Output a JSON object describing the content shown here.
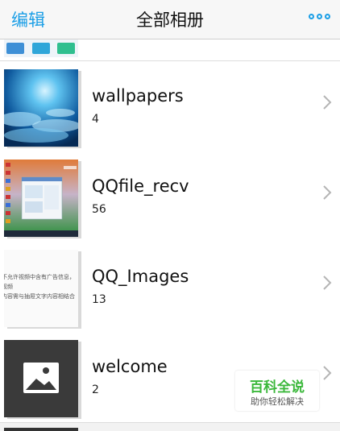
{
  "navbar": {
    "edit_label": "编辑",
    "title": "全部相册",
    "more_icon": "ellipsis-icon"
  },
  "albums": [
    {
      "name": "wallpapers",
      "count": "4",
      "thumbnail": "wallpaper-photo"
    },
    {
      "name": "QQfile_recv",
      "count": "56",
      "thumbnail": "desktop-screenshot"
    },
    {
      "name": "QQ_Images",
      "count": "13",
      "thumbnail": "text-screenshot",
      "thumb_text": [
        "不允许视频中含有广告信息，",
        "视频",
        "内容需与抽屉文字内容相结合"
      ]
    },
    {
      "name": "welcome",
      "count": "2",
      "thumbnail": "image-placeholder-icon"
    }
  ],
  "watermark": {
    "title": "百科全说",
    "subtitle": "助你轻松解决"
  },
  "colors": {
    "accent": "#1a9ee6",
    "watermark_green": "#3cb83c"
  }
}
